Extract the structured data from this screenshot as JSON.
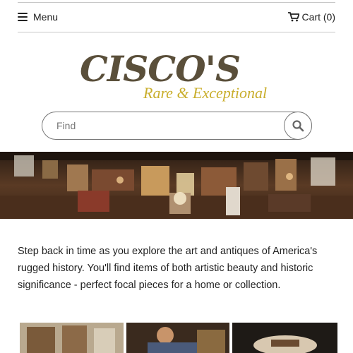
{
  "header": {
    "menu_label": "Menu",
    "cart_label": "Cart (0)",
    "menu_icon": "hamburger-icon",
    "cart_icon": "cart-icon"
  },
  "logo": {
    "main": "CISCO'S",
    "tagline": "Rare & Exceptional",
    "main_color": "#5a4f3a",
    "tagline_color": "#c9ae2c"
  },
  "search": {
    "placeholder": "Find",
    "icon": "search-icon"
  },
  "intro": {
    "text": "Step back in time as you explore the art and antiques of America's rugged history. You'll find items of both artistic beauty and historic significance - perfect focal pieces for a home or collection."
  }
}
